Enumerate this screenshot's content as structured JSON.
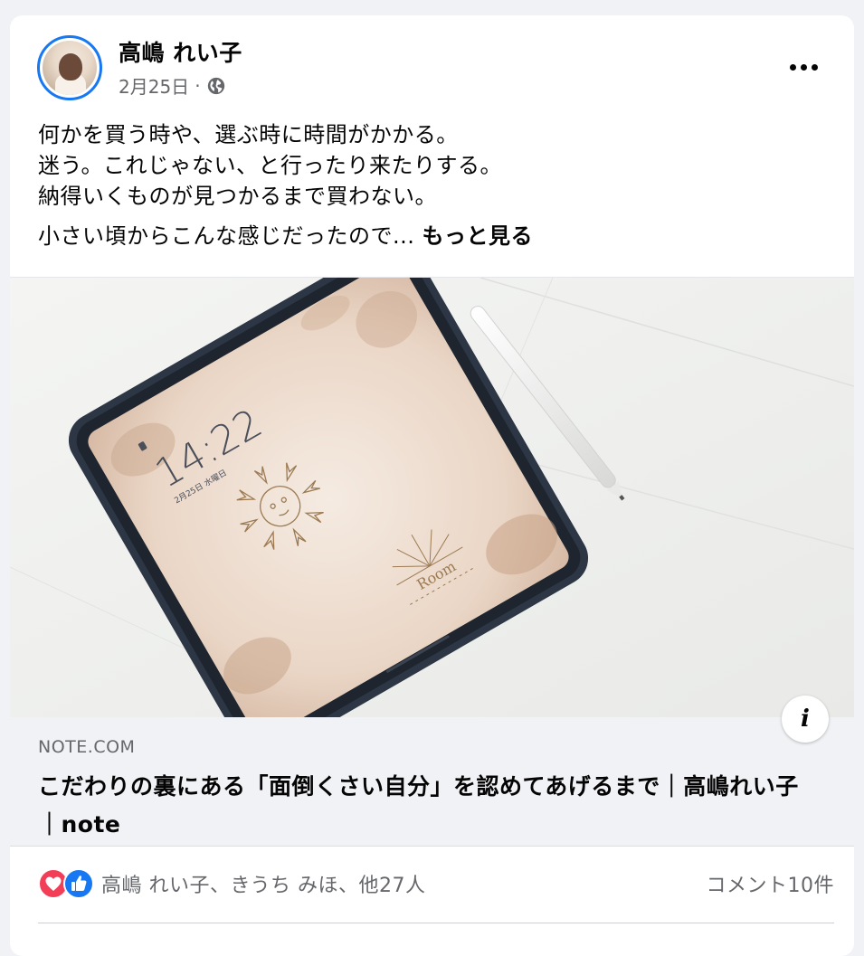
{
  "post": {
    "author_name": "高嶋 れい子",
    "date": "2月25日",
    "separator": "·",
    "privacy_icon": "globe-icon",
    "more_icon": "more-horizontal-icon",
    "text_lines": [
      "何かを買う時や、選ぶ時に時間がかかる。",
      "迷う。これじゃない、と行ったり来たりする。",
      "納得いくものが見つかるまで買わない。"
    ],
    "text_truncated": "小さい頃からこんな感じだったので... ",
    "see_more_label": "もっと見る"
  },
  "link_preview": {
    "image_icon": "tablet-photo",
    "tablet_time": "14:22",
    "tablet_date": "2月25日 水曜日",
    "tablet_room_label": "Room",
    "info_label": "i",
    "domain": "NOTE.COM",
    "title": "こだわりの裏にある「面倒くさい自分」を認めてあげるまで｜高嶋れい子｜note"
  },
  "engagement": {
    "reaction_icons": [
      "love-reaction-icon",
      "like-reaction-icon"
    ],
    "reactors_text": "高嶋 れい子、きうち みほ、他27人",
    "comments_text": "コメント10件"
  },
  "colors": {
    "brand_blue": "#1877f2",
    "love_red": "#f33e58",
    "secondary_text": "#65676b",
    "page_bg": "#f0f2f5"
  }
}
